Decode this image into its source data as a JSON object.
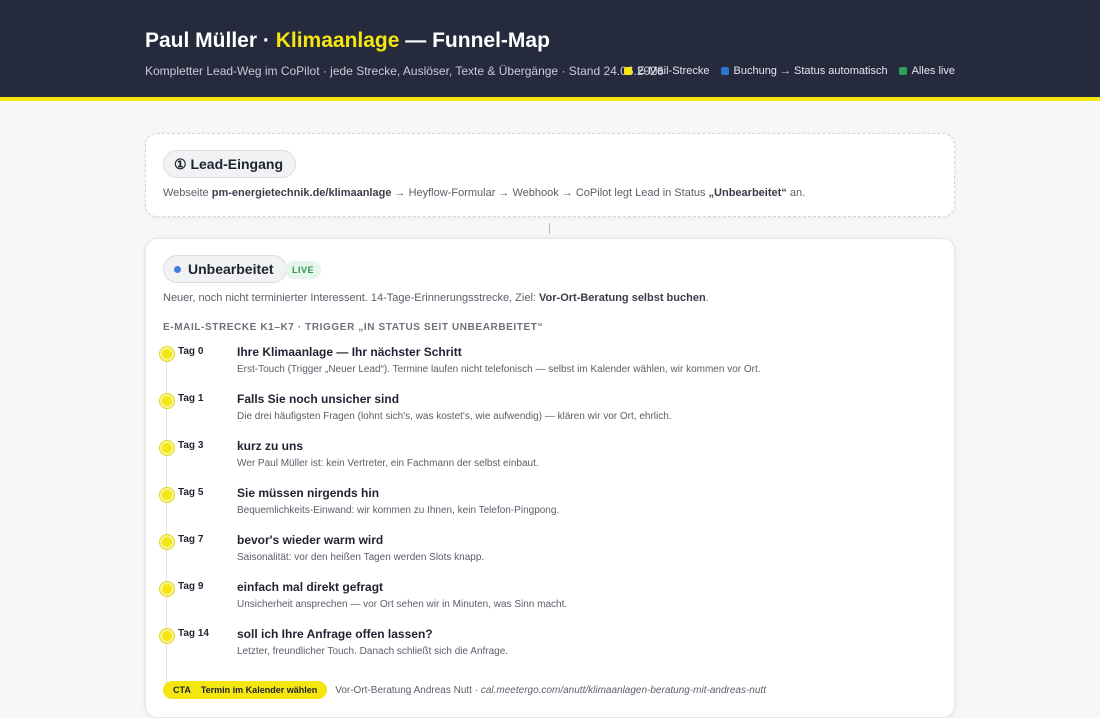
{
  "header": {
    "name": "Paul Müller ·",
    "accent": "Klimaanlage",
    "suffix": "— Funnel-Map",
    "subtitle": "Kompletter Lead-Weg im CoPilot · jede Strecke, Auslöser, Texte & Übergänge · Stand 24.06.2026",
    "legend": [
      {
        "label": "E-Mail-Strecke",
        "color": "#f5e60f"
      },
      {
        "label": "Buchung → Status automatisch",
        "color": "#2f74d0"
      },
      {
        "label": "Alles live",
        "color": "#2fa05a"
      }
    ]
  },
  "lead_entry": {
    "title": "① Lead-Eingang",
    "desc_prefix": "Webseite ",
    "desc_domain": "pm-energietechnik.de/klimaanlage",
    "desc_middle": " → Heyflow-Formular → Webhook → CoPilot legt Lead in Status ",
    "desc_status": "„Unbearbeitet“",
    "desc_suffix": " an."
  },
  "stage": {
    "title": "Unbearbeitet",
    "badge": "LIVE",
    "desc_prefix": "Neuer, noch nicht terminierter Interessent. 14-Tage-Erinnerungsstrecke, Ziel: ",
    "desc_goal": "Vor-Ort-Beratung selbst buchen",
    "desc_suffix": ".",
    "sequence_label": "E-MAIL-STRECKE K1–K7 · TRIGGER „IN STATUS SEIT UNBEARBEITET“",
    "steps": [
      {
        "day": "Tag 0",
        "title": "Ihre Klimaanlage — Ihr nächster Schritt",
        "text": "Erst-Touch (Trigger „Neuer Lead“). Termine laufen nicht telefonisch — selbst im Kalender wählen, wir kommen vor Ort."
      },
      {
        "day": "Tag 1",
        "title": "Falls Sie noch unsicher sind",
        "text": "Die drei häufigsten Fragen (lohnt sich's, was kostet's, wie aufwendig) — klären wir vor Ort, ehrlich."
      },
      {
        "day": "Tag 3",
        "title": "kurz zu uns",
        "text": "Wer Paul Müller ist: kein Vertreter, ein Fachmann der selbst einbaut."
      },
      {
        "day": "Tag 5",
        "title": "Sie müssen nirgends hin",
        "text": "Bequemlichkeits-Einwand: wir kommen zu Ihnen, kein Telefon-Pingpong."
      },
      {
        "day": "Tag 7",
        "title": "bevor's wieder warm wird",
        "text": "Saisonalität: vor den heißen Tagen werden Slots knapp."
      },
      {
        "day": "Tag 9",
        "title": "einfach mal direkt gefragt",
        "text": "Unsicherheit ansprechen — vor Ort sehen wir in Minuten, was Sinn macht."
      },
      {
        "day": "Tag 14",
        "title": "soll ich Ihre Anfrage offen lassen?",
        "text": "Letzter, freundlicher Touch. Danach schließt sich die Anfrage."
      }
    ],
    "cta": {
      "tag": "CTA",
      "button": "Termin im Kalender wählen",
      "text_prefix": "Vor-Ort-Beratung Andreas Nutt · ",
      "link": "cal.meetergo.com/anutt/klimaanlagen-beratung-mit-andreas-nutt"
    }
  }
}
